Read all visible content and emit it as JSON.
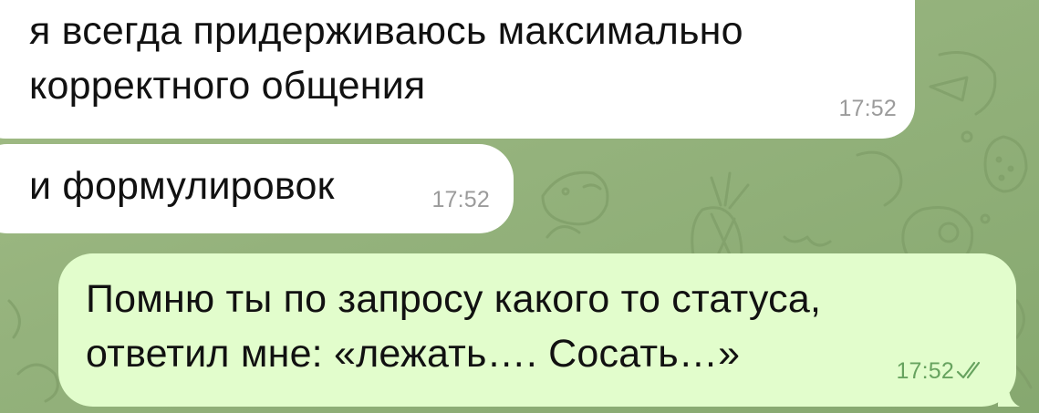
{
  "chat": {
    "background_color": "#94b27c",
    "messages": [
      {
        "direction": "incoming",
        "lines": [
          "я всегда придерживаюсь максимально",
          "корректного общения"
        ],
        "time": "17:52"
      },
      {
        "direction": "incoming",
        "lines": [
          "и формулировок"
        ],
        "time": "17:52"
      },
      {
        "direction": "outgoing",
        "lines": [
          "Помню ты по запросу какого то статуса,",
          "ответил мне: «лежать…. Сосать…»"
        ],
        "time": "17:52",
        "status_icon": "double-check-icon",
        "bubble_color": "#e2fdcc",
        "status_color": "#67a35f"
      }
    ]
  }
}
